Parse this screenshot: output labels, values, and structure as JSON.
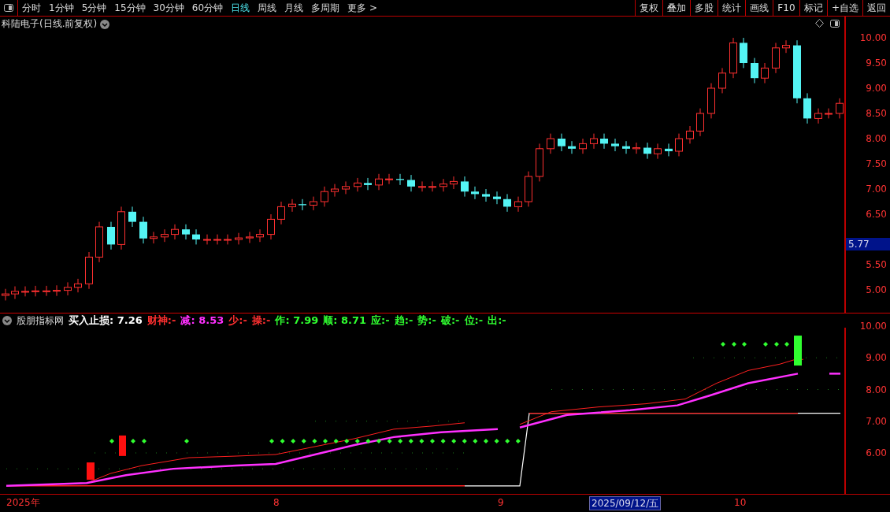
{
  "toolbar": {
    "periods": [
      {
        "label": "分时",
        "selected": false
      },
      {
        "label": "1分钟",
        "selected": false
      },
      {
        "label": "5分钟",
        "selected": false
      },
      {
        "label": "15分钟",
        "selected": false
      },
      {
        "label": "30分钟",
        "selected": false
      },
      {
        "label": "60分钟",
        "selected": false
      },
      {
        "label": "日线",
        "selected": true
      },
      {
        "label": "周线",
        "selected": false
      },
      {
        "label": "月线",
        "selected": false
      },
      {
        "label": "多周期",
        "selected": false
      },
      {
        "label": "更多 >",
        "selected": false
      }
    ],
    "actions": [
      "复权",
      "叠加",
      "多股",
      "统计",
      "画线",
      "F10",
      "标记",
      "+自选",
      "返回"
    ]
  },
  "main_chart": {
    "title": "科陆电子(日线.前复权)",
    "price_labels": [
      "10.00",
      "9.50",
      "9.00",
      "8.50",
      "8.00",
      "7.50",
      "7.00",
      "6.50",
      "5.50",
      "5.00"
    ],
    "current_price": "5.77"
  },
  "indicator": {
    "name": "股朋指标网",
    "items": [
      {
        "label": "买入止损: 7.26",
        "color": "#ffffff"
      },
      {
        "label": "财神:-",
        "color": "#ff3030"
      },
      {
        "label": "减: 8.53",
        "color": "#ff30ff"
      },
      {
        "label": "少:-",
        "color": "#ff3030"
      },
      {
        "label": "操:-",
        "color": "#ff3030"
      },
      {
        "label": "作: 7.99",
        "color": "#30ff30"
      },
      {
        "label": "顺: 8.71",
        "color": "#30ff30"
      },
      {
        "label": "应:-",
        "color": "#30ff30"
      },
      {
        "label": "趋:-",
        "color": "#30ff30"
      },
      {
        "label": "势:-",
        "color": "#30ff30"
      },
      {
        "label": "破:-",
        "color": "#30ff30"
      },
      {
        "label": "位:-",
        "color": "#30ff30"
      },
      {
        "label": "出:-",
        "color": "#30ff30"
      }
    ],
    "axis_labels": [
      "10.00",
      "9.00",
      "8.00",
      "7.00",
      "6.00"
    ]
  },
  "date_axis": [
    {
      "label": "2025年",
      "selected": false
    },
    {
      "label": "8",
      "selected": false
    },
    {
      "label": "9",
      "selected": false
    },
    {
      "label": "2025/09/12/五",
      "selected": true
    },
    {
      "label": "10",
      "selected": false
    }
  ]
}
